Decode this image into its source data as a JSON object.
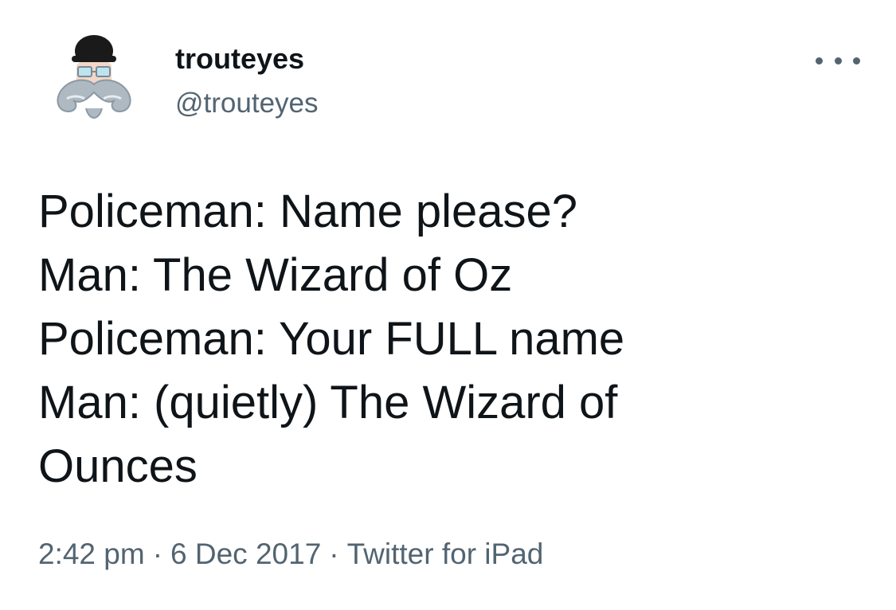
{
  "author": {
    "display_name": "trouteyes",
    "handle": "@trouteyes",
    "avatar_icon": "mustache-bowler-hat-avatar"
  },
  "more_icon": "more-horizontal-icon",
  "tweet": {
    "lines": [
      "Policeman: Name please?",
      "Man: The Wizard of Oz",
      "Policeman: Your FULL name",
      "Man: (quietly) The Wizard of",
      "Ounces"
    ]
  },
  "meta": {
    "time": "2:42 pm",
    "separator": "·",
    "date": "6 Dec 2017",
    "source": "Twitter for iPad"
  },
  "colors": {
    "text": "#0f1419",
    "secondary": "#536471",
    "background": "#ffffff"
  }
}
